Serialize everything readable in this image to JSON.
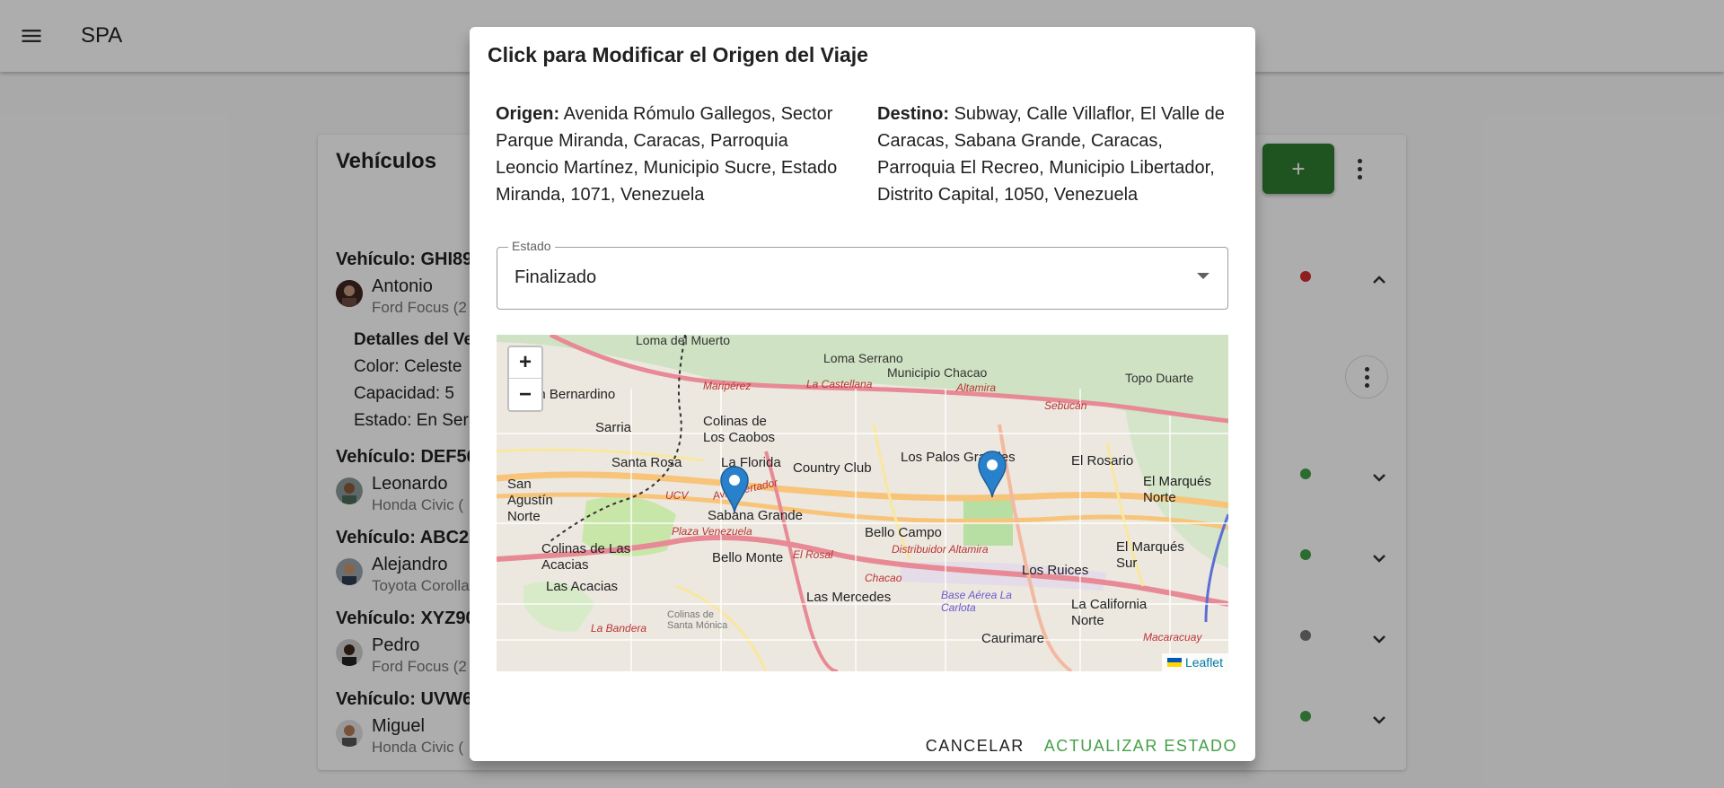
{
  "app": {
    "title": "SPA"
  },
  "vehicles": {
    "title": "Vehículos",
    "add_label": "+",
    "items": [
      {
        "title": "Vehículo: GHI89",
        "driver": "Antonio",
        "model": "Ford Focus (2",
        "status_color": "#d32f2f",
        "expanded": true,
        "details": {
          "heading": "Detalles del Ve",
          "color": "Color: Celeste",
          "capacity": "Capacidad: 5",
          "state": "Estado: En Ser"
        }
      },
      {
        "title": "Vehículo: DEF56",
        "driver": "Leonardo",
        "model": "Honda Civic (",
        "status_color": "#43a047"
      },
      {
        "title": "Vehículo: ABC23",
        "driver": "Alejandro",
        "model": "Toyota Corolla",
        "status_color": "#43a047"
      },
      {
        "title": "Vehículo: XYZ90",
        "driver": "Pedro",
        "model": "Ford Focus (2",
        "status_color": "#757575"
      },
      {
        "title": "Vehículo: UVW6",
        "driver": "Miguel",
        "model": "Honda Civic (",
        "status_color": "#43a047"
      }
    ]
  },
  "dialog": {
    "title": "Click para Modificar el Origen del Viaje",
    "origin_label": "Origen:",
    "origin_text": "Avenida Rómulo Gallegos, Sector Parque Miranda, Caracas, Parroquia Leoncio Martínez, Municipio Sucre, Estado Miranda, 1071, Venezuela",
    "destination_label": "Destino:",
    "destination_text": "Subway, Calle Villaflor, El Valle de Caracas, Sabana Grande, Caracas, Parroquia El Recreo, Municipio Libertador, Distrito Capital, 1050, Venezuela",
    "status_field": {
      "label": "Estado",
      "value": "Finalizado"
    },
    "map": {
      "zoom_in": "+",
      "zoom_out": "−",
      "attribution": "Leaflet",
      "labels": [
        "Loma del Muerto",
        "Loma Serrano",
        "Municipio Chacao",
        "Topo Duarte",
        "San Bernardino",
        "Maripérez",
        "La Castellana",
        "Altamira",
        "Sebucán",
        "Sarria",
        "Colinas de Los Caobos",
        "Santa Rosa",
        "La Florida",
        "Country Club",
        "Los Palos Grandes",
        "El Rosario",
        "El Marqués Norte",
        "San Agustín Norte",
        "Av. Libertador",
        "Sabana Grande",
        "Plaza Venezuela",
        "Bello Campo",
        "UCV",
        "Colinas de Las Acacias",
        "Las Acacias",
        "Bello Monte",
        "El Rosal",
        "Distribuidor Altamira",
        "El Marqués Sur",
        "Los Ruices",
        "Las Mercedes",
        "Base Aérea La Carlota",
        "La California Norte",
        "Colinas de Santa Mónica",
        "La Bandera",
        "Caurimare",
        "Macaracuay",
        "Chacao"
      ]
    },
    "actions": {
      "cancel": "CANCELAR",
      "update": "ACTUALIZAR ESTADO"
    }
  }
}
